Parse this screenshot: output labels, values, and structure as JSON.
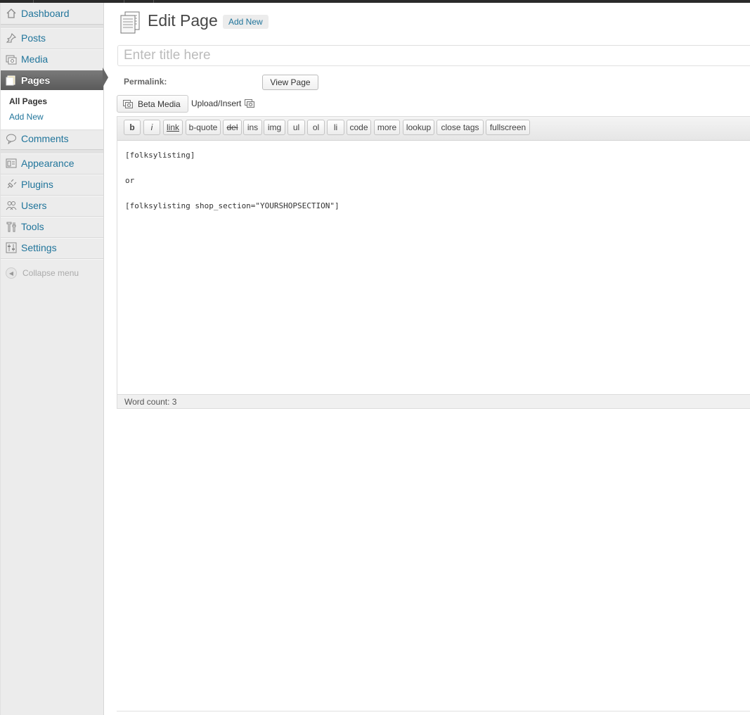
{
  "sidebar": {
    "dashboard": "Dashboard",
    "posts": "Posts",
    "media": "Media",
    "pages": "Pages",
    "submenu": {
      "all_pages": "All Pages",
      "add_new": "Add New"
    },
    "comments": "Comments",
    "appearance": "Appearance",
    "plugins": "Plugins",
    "users": "Users",
    "tools": "Tools",
    "settings": "Settings",
    "collapse": "Collapse menu"
  },
  "header": {
    "title": "Edit Page",
    "add_new": "Add New"
  },
  "title_field": {
    "placeholder": "Enter title here",
    "value": ""
  },
  "permalink": {
    "label": "Permalink:",
    "view_button": "View Page"
  },
  "media_buttons": {
    "beta_media": "Beta Media",
    "upload_insert": "Upload/Insert"
  },
  "quicktags": [
    "b",
    "i",
    "link",
    "b-quote",
    "del",
    "ins",
    "img",
    "ul",
    "ol",
    "li",
    "code",
    "more",
    "lookup",
    "close tags",
    "fullscreen"
  ],
  "editor": {
    "lines": [
      "[folksylisting]",
      "",
      "or",
      "",
      "[folksylisting shop_section=\"YOURSHOPSECTION\"]"
    ],
    "word_count": "Word count: 3"
  }
}
